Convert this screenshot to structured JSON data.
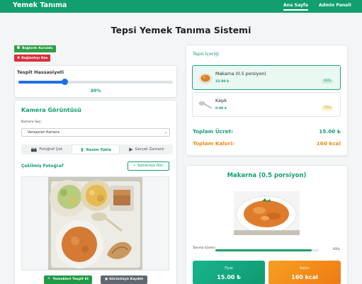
{
  "colors": {
    "brand": "#129e6f",
    "connected_badge": "#2e9e46",
    "disconnect_badge": "#d9303c",
    "slider_accent": "#1e6fe8",
    "price_total": "#129e6f",
    "calorie_total": "#f08a16",
    "detect_button": "#1f9a45",
    "save_button": "#5f6770"
  },
  "navbar": {
    "brand": "Yemek Tanıma",
    "links": [
      {
        "label": "Ana Sayfa",
        "active": true
      },
      {
        "label": "Admin Paneli",
        "active": false
      }
    ]
  },
  "page_title": "Tepsi Yemek Tanıma Sistemi",
  "connection": {
    "status_label": "Bağlantı Kuruldu",
    "disconnect_label": "Bağlantıyı Kes"
  },
  "sensitivity": {
    "title": "Tespit Hassasiyeti",
    "value": 30,
    "value_label": "30%"
  },
  "camera": {
    "section_title": "Kamera Görüntüsü",
    "select_label": "Kamera Seç:",
    "select_value": "Varsayılan Kamera",
    "tabs": [
      {
        "label": "Fotoğraf Çek",
        "icon": "camera-icon",
        "active": false
      },
      {
        "label": "Resim Yükle",
        "icon": "upload-icon",
        "active": true
      },
      {
        "label": "Gerçek Zamanlı",
        "icon": "video-icon",
        "active": false
      }
    ],
    "captured_label": "Çekilmiş Fotoğraf",
    "back_button": "Kameraya Dön",
    "detect_button": "Yemekleri Tespit Et",
    "save_button": "Görüntüyü Kaydet"
  },
  "tray": {
    "title": "Tepsi İçeriği",
    "items": [
      {
        "name": "Makarna (0.5 porsiyon)",
        "price": "15.00 ₺",
        "confidence": "93%",
        "icon": "pasta-icon",
        "selected": true
      },
      {
        "name": "Kaşık",
        "price": "0.00 ₺",
        "confidence": "70%",
        "icon": "spoon-icon",
        "selected": false
      }
    ],
    "total_price_label": "Toplam Ücret:",
    "total_price_value": "15.00 ₺",
    "total_cal_label": "Toplam Kalori:",
    "total_cal_value": "160 kcal"
  },
  "detail": {
    "title": "Makarna (0.5 porsiyon)",
    "confidence_label": "Tanıma Güveni",
    "confidence_value": "93%",
    "confidence_level": 0.93,
    "price_label": "Fiyat",
    "price_value": "15.00 ₺",
    "calorie_label": "Kalori",
    "calorie_value": "160 kcal"
  }
}
